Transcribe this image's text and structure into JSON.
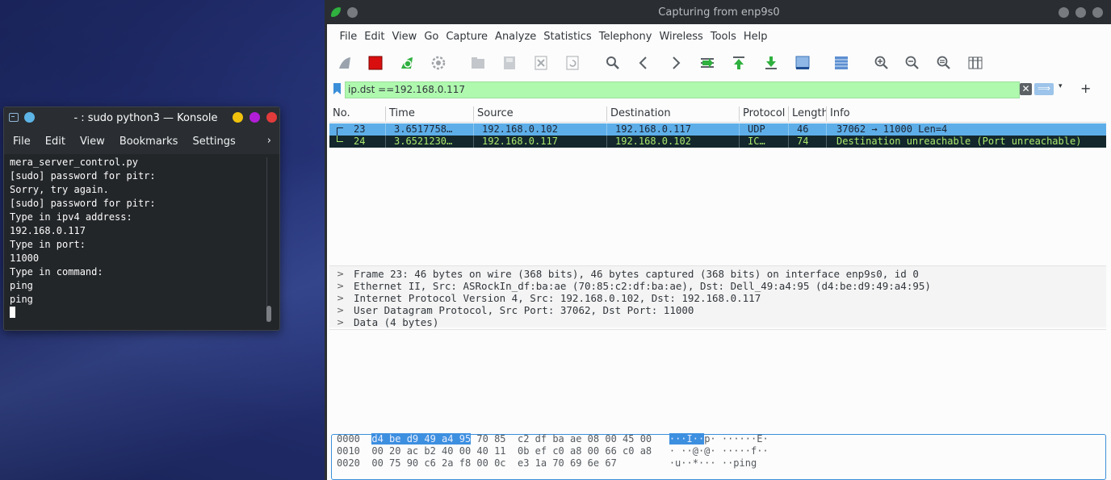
{
  "konsole": {
    "title": "- : sudo python3 — Konsole",
    "menu": [
      "File",
      "Edit",
      "View",
      "Bookmarks",
      "Settings"
    ],
    "more": "›",
    "lines": [
      "mera_server_control.py",
      "[sudo] password for pitr:",
      "Sorry, try again.",
      "[sudo] password for pitr:",
      "Type in ipv4 address:",
      "192.168.0.117",
      "Type in port:",
      "11000",
      "Type in command:",
      "ping",
      "ping"
    ]
  },
  "wireshark": {
    "title": "Capturing from enp9s0",
    "menu": [
      "File",
      "Edit",
      "View",
      "Go",
      "Capture",
      "Analyze",
      "Statistics",
      "Telephony",
      "Wireless",
      "Tools",
      "Help"
    ],
    "filter": {
      "value": "ip.dst ==192.168.0.117",
      "clear_glyph": "✕",
      "apply_glyph": "⟹",
      "dropdown_glyph": "▾",
      "add_glyph": "+"
    },
    "columns": [
      "No.",
      "Time",
      "Source",
      "Destination",
      "Protocol",
      "Length",
      "Info"
    ],
    "packets": [
      {
        "no": "23",
        "time": "3.6517758…",
        "src": "192.168.0.102",
        "dst": "192.168.0.117",
        "proto": "UDP",
        "len": "46",
        "info": "37062 → 11000 Len=4"
      },
      {
        "no": "24",
        "time": "3.6521230…",
        "src": "192.168.0.117",
        "dst": "192.168.0.102",
        "proto": "IC…",
        "len": "74",
        "info": "Destination unreachable (Port unreachable)"
      }
    ],
    "details": [
      "Frame 23: 46 bytes on wire (368 bits), 46 bytes captured (368 bits) on interface enp9s0, id 0",
      "Ethernet II, Src: ASRockIn_df:ba:ae (70:85:c2:df:ba:ae), Dst: Dell_49:a4:95 (d4:be:d9:49:a4:95)",
      "Internet Protocol Version 4, Src: 192.168.0.102, Dst: 192.168.0.117",
      "User Datagram Protocol, Src Port: 37062, Dst Port: 11000",
      "Data (4 bytes)"
    ],
    "hex": [
      {
        "offset": "0000",
        "hl": "d4 be d9 49 a4 95",
        "bytes": " 70 85  c2 df ba ae 08 00 45 00",
        "ascii_hl": "···I··",
        "ascii": "p· ······E·"
      },
      {
        "offset": "0010",
        "hl": "",
        "bytes": "00 20 ac b2 40 00 40 11  0b ef c0 a8 00 66 c0 a8",
        "ascii_hl": "",
        "ascii": "· ··@·@· ·····f··"
      },
      {
        "offset": "0020",
        "hl": "",
        "bytes": "00 75 90 c6 2a f8 00 0c  e3 1a 70 69 6e 67",
        "ascii_hl": "",
        "ascii": "·u··*··· ··ping"
      }
    ],
    "colors": {
      "selected_row": "#5daee8",
      "icmp_row_bg": "#13272d",
      "icmp_row_fg": "#abe86c",
      "filter_bg": "#aff9af"
    }
  }
}
